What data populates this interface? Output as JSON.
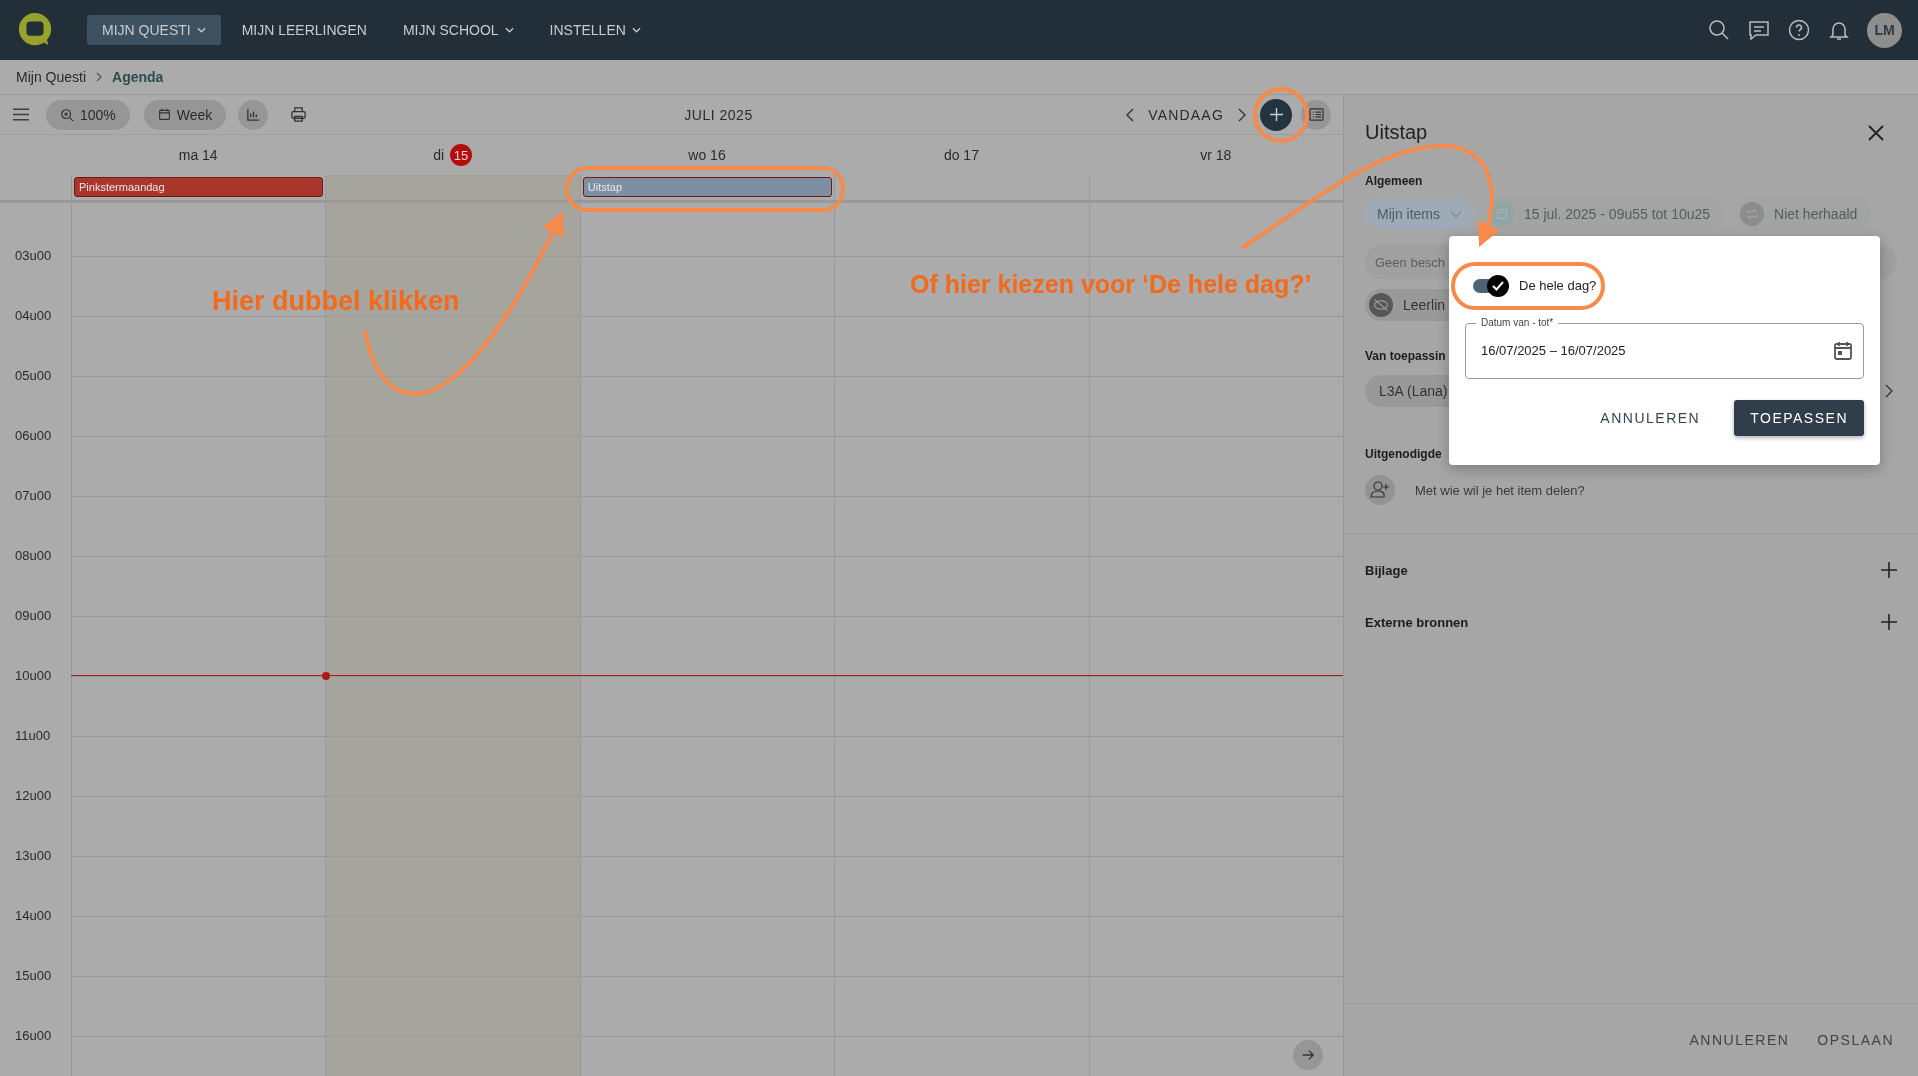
{
  "top_nav": {
    "items": [
      {
        "label": "MIJN QUESTI",
        "selected": true,
        "dropdown": true
      },
      {
        "label": "MIJN LEERLINGEN",
        "selected": false,
        "dropdown": false
      },
      {
        "label": "MIJN SCHOOL",
        "selected": false,
        "dropdown": true
      },
      {
        "label": "INSTELLEN",
        "selected": false,
        "dropdown": true
      }
    ],
    "avatar": "LM"
  },
  "breadcrumb": [
    "Mijn Questi",
    "Agenda"
  ],
  "toolbar": {
    "zoom": "100%",
    "view": "Week",
    "period": "JULI 2025",
    "today": "VANDAAG"
  },
  "calendar": {
    "days": [
      {
        "weekday": "ma",
        "date": "14",
        "today": false,
        "events": [
          {
            "title": "Pinkstermaandag",
            "color": "#a8362b"
          }
        ]
      },
      {
        "weekday": "di",
        "date": "15",
        "today": true
      },
      {
        "weekday": "wo",
        "date": "16",
        "today": false,
        "events": [
          {
            "title": "Uitstap",
            "color": "#7d8fa3"
          }
        ]
      },
      {
        "weekday": "do",
        "date": "17",
        "today": false
      },
      {
        "weekday": "vr",
        "date": "18",
        "today": false
      }
    ],
    "hours": [
      {
        "label": "03u00",
        "now": false
      },
      {
        "label": "04u00",
        "now": false
      },
      {
        "label": "05u00",
        "now": false
      },
      {
        "label": "06u00",
        "now": false
      },
      {
        "label": "07u00",
        "now": false
      },
      {
        "label": "08u00",
        "now": false
      },
      {
        "label": "09u00",
        "now": false
      },
      {
        "label": "10u00",
        "now": true
      },
      {
        "label": "11u00",
        "now": false
      },
      {
        "label": "12u00",
        "now": false
      },
      {
        "label": "13u00",
        "now": false
      },
      {
        "label": "14u00",
        "now": false
      },
      {
        "label": "15u00",
        "now": false
      },
      {
        "label": "16u00",
        "now": false
      }
    ]
  },
  "panel": {
    "title": "Uitstap",
    "general_heading": "Algemeen",
    "calendar_select": "Mijn items",
    "datetime": "15 jul. 2025 - 09u55 tot 10u25",
    "repeat": "Niet herhaald",
    "description_placeholder": "Geen besch",
    "visibility": "Leerlin",
    "applies_heading": "Van toepassin",
    "groups": [
      "L3A (Lana)"
    ],
    "invited_heading": "Uitgenodigde",
    "share_placeholder": "Met wie wil je het item delen?",
    "sections": [
      "Bijlage",
      "Externe bronnen"
    ],
    "buttons": [
      "ANNULEREN",
      "OPSLAAN"
    ]
  },
  "dialog": {
    "all_day": {
      "label": "De hele dag?",
      "on": true
    },
    "date_field": {
      "label": "Datum van - tot*",
      "value": "16/07/2025 – 16/07/2025"
    },
    "buttons": [
      "ANNULEREN",
      "TOEPASSEN"
    ]
  },
  "annotations": [
    {
      "text": "Hier dubbel klikken"
    },
    {
      "text": "Of hier kiezen voor ‘De hele dag?’"
    }
  ]
}
